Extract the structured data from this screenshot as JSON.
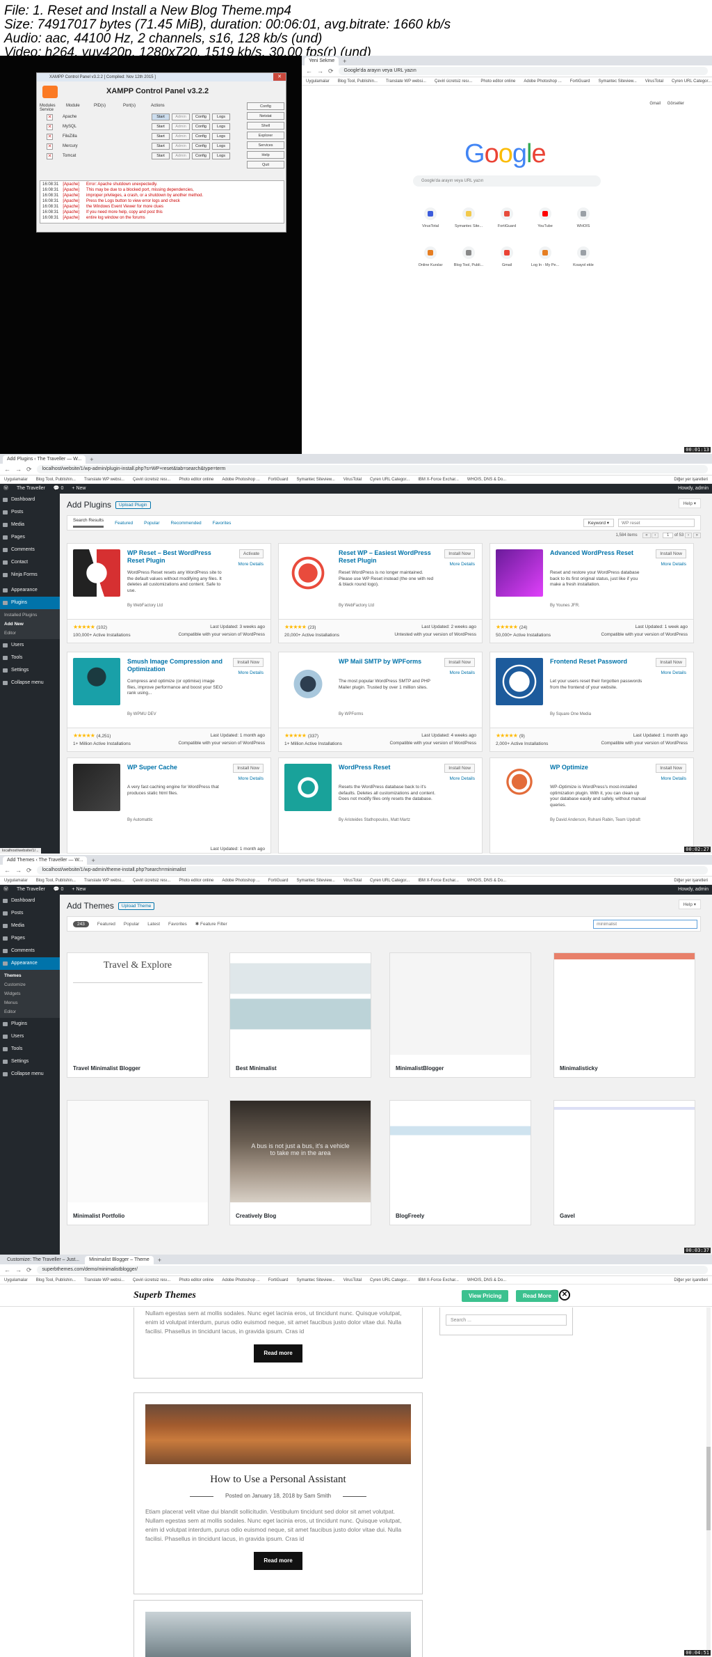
{
  "file_info": {
    "line1": "File: 1. Reset and Install a New Blog Theme.mp4",
    "line2": "Size: 74917017 bytes (71.45 MiB), duration: 00:06:01, avg.bitrate: 1660 kb/s",
    "line3": "Audio: aac, 44100 Hz, 2 channels, s16, 128 kb/s (und)",
    "line4": "Video: h264, yuv420p, 1280x720, 1519 kb/s, 30.00 fps(r) (und)"
  },
  "timestamps": [
    "00:01:13",
    "00:02:27",
    "00:03:37",
    "00:04:51"
  ],
  "bookmarks": [
    "Uygulamalar",
    "Blog Tool, Publishin...",
    "Translate WP websi...",
    "Çeviri ücretsiz resı...",
    "Photo editor online",
    "Adobe Photoshop ...",
    "FortiGuard",
    "Symantec Siteview...",
    "VirusTotal",
    "Cyren URL Categor...",
    "IBM X-Force Exchar...",
    "WHOIS, DNS & Do..."
  ],
  "bookmarks_right": "Diğer yer işaretleri",
  "xampp": {
    "title": "XAMPP Control Panel v3.2.2   [ Compiled: Nov 12th 2015 ]",
    "heading": "XAMPP Control Panel v3.2.2",
    "columns": [
      "Modules Service",
      "Module",
      "PID(s)",
      "Port(s)",
      "Actions"
    ],
    "modules": [
      "Apache",
      "MySQL",
      "FileZilla",
      "Mercury",
      "Tomcat"
    ],
    "actions": [
      "Start",
      "Admin",
      "Config",
      "Logs"
    ],
    "side_buttons": [
      "Config",
      "Netstat",
      "Shell",
      "Explorer",
      "Services",
      "Help",
      "Quit"
    ],
    "log_times": [
      "16:08:31",
      "16:08:31",
      "16:08:31",
      "16:08:31",
      "16:08:31",
      "16:08:31",
      "16:08:31"
    ],
    "log_src": "[Apache]",
    "log_lines": [
      "Error: Apache shutdown unexpectedly.",
      "This may be due to a blocked port, missing dependencies,",
      "improper privileges, a crash, or a shutdown by another method.",
      "Press the Logs button to view error logs and check",
      "the Windows Event Viewer for more clues",
      "If you need more help, copy and post this",
      "entire log window on the forums"
    ]
  },
  "chrome_p1": {
    "tab": "Yeni Sekme",
    "address": "Google'da arayın veya URL yazın",
    "top_links": [
      "Gmail",
      "Görseller"
    ],
    "logo": "Google",
    "search_placeholder": "Google'da arayın veya URL yazın",
    "shortcuts_row1": [
      "VirusTotal",
      "Symantec Site...",
      "FortiGuard",
      "YouTube",
      "WHOIS"
    ],
    "shortcuts_row2": [
      "Online Kurslar",
      "Blog Tool, Publi...",
      "Gmail",
      "Log In - My Pe...",
      "Kısayol ekle"
    ]
  },
  "wp_plugins": {
    "tab": "Add Plugins ‹ The Traveller — W...",
    "url": "localhost/website/1/wp-admin/plugin-install.php?s=WP+reset&tab=search&type=term",
    "site": "The Traveller",
    "new": "+ New",
    "howdy": "Howdy, admin",
    "help": "Help ▾",
    "title": "Add Plugins",
    "upload": "Upload Plugin",
    "filters": [
      "Search Results",
      "Featured",
      "Popular",
      "Recommended",
      "Favorites"
    ],
    "keyword": "Keyword ▾",
    "search": "WP reset",
    "items_count": "1,584 items",
    "page": "1",
    "of_pages": "of 53",
    "status_link": "localhost/website/1/...",
    "menu": [
      "Dashboard",
      "Posts",
      "Media",
      "Pages",
      "Comments",
      "Contact",
      "Ninja Forms",
      "Appearance",
      "Plugins"
    ],
    "sub": [
      "Installed Plugins",
      "Add New",
      "Editor"
    ],
    "menu2": [
      "Users",
      "Tools",
      "Settings",
      "Collapse menu"
    ],
    "cards": [
      {
        "name": "WP Reset – Best WordPress Reset Plugin",
        "desc": "WordPress Reset resets any WordPress site to the default values without modifying any files. It deletes all customizations and content. Safe to use.",
        "by": "By WebFactory Ltd",
        "btn": "Activate",
        "more": "More Details",
        "rating": "(102)",
        "installs": "100,000+ Active Installations",
        "updated": "Last Updated: 3 weeks ago",
        "compat": "Compatible with your version of WordPress"
      },
      {
        "name": "Reset WP – Easiest WordPress Reset Plugin",
        "desc": "Reset WordPress is no longer maintained. Please use WP Reset instead (the one with red & black round logo).",
        "by": "By WebFactory Ltd",
        "btn": "Install Now",
        "more": "More Details",
        "rating": "(23)",
        "installs": "20,000+ Active Installations",
        "updated": "Last Updated: 2 weeks ago",
        "compat": "Untested with your version of WordPress"
      },
      {
        "name": "Advanced WordPress Reset",
        "desc": "Reset and restore your WordPress database back to its first original status, just like if you make a fresh installation.",
        "by": "By Younes JFR.",
        "btn": "Install Now",
        "more": "More Details",
        "rating": "(24)",
        "installs": "50,000+ Active Installations",
        "updated": "Last Updated: 1 week ago",
        "compat": "Compatible with your version of WordPress"
      },
      {
        "name": "Smush Image Compression and Optimization",
        "desc": "Compress and optimize (or optimise) image files, improve performance and boost your SEO rank using...",
        "by": "By WPMU DEV",
        "btn": "Install Now",
        "more": "More Details",
        "rating": "(4,251)",
        "installs": "1+ Million Active Installations",
        "updated": "Last Updated: 1 month ago",
        "compat": "Compatible with your version of WordPress"
      },
      {
        "name": "WP Mail SMTP by WPForms",
        "desc": "The most popular WordPress SMTP and PHP Mailer plugin. Trusted by over 1 million sites.",
        "by": "By WPForms",
        "btn": "Install Now",
        "more": "More Details",
        "rating": "(337)",
        "installs": "1+ Million Active Installations",
        "updated": "Last Updated: 4 weeks ago",
        "compat": "Compatible with your version of WordPress"
      },
      {
        "name": "Frontend Reset Password",
        "desc": "Let your users reset their forgotten passwords from the frontend of your website.",
        "by": "By Square One Media",
        "btn": "Install Now",
        "more": "More Details",
        "rating": "(9)",
        "installs": "2,000+ Active Installations",
        "updated": "Last Updated: 1 month ago",
        "compat": "Compatible with your version of WordPress"
      },
      {
        "name": "WP Super Cache",
        "desc": "A very fast caching engine for WordPress that produces static html files.",
        "by": "By Automattic",
        "btn": "Install Now",
        "more": "More Details",
        "rating": "",
        "installs": "",
        "updated": "Last Updated: 1 month ago",
        "compat": ""
      },
      {
        "name": "WordPress Reset",
        "desc": "Resets the WordPress database back to it's defaults. Deletes all customizations and content. Does not modify files only resets the database.",
        "by": "By Aristeides Stathopoulos, Matt Martz",
        "btn": "Install Now",
        "more": "More Details",
        "rating": "",
        "installs": "",
        "updated": "",
        "compat": ""
      },
      {
        "name": "WP Optimize",
        "desc": "WP-Optimize is WordPress's most-installed optimization plugin. With it, you can clean up your database easily and safely, without manual queries.",
        "by": "By David Anderson, Ruhani Rabin, Team Updraft",
        "btn": "Install Now",
        "more": "More Details",
        "rating": "",
        "installs": "",
        "updated": "",
        "compat": ""
      }
    ]
  },
  "wp_themes": {
    "tab": "Add Themes ‹ The Traveller — W...",
    "url": "localhost/website/1/wp-admin/theme-install.php?search=minimalist",
    "title": "Add Themes",
    "upload": "Upload Theme",
    "count": "243",
    "filters": [
      "Featured",
      "Popular",
      "Latest",
      "Favorites",
      "✱ Feature Filter"
    ],
    "search": "minimalist",
    "menu": [
      "Dashboard",
      "Posts",
      "Media",
      "Pages",
      "Comments",
      "Appearance"
    ],
    "sub": [
      "Themes",
      "Customize",
      "Widgets",
      "Menus",
      "Editor"
    ],
    "menu2": [
      "Plugins",
      "Users",
      "Tools",
      "Settings",
      "Collapse menu"
    ],
    "themes": [
      "Travel Minimalist Blogger",
      "Best Minimalist",
      "MinimalistBlogger",
      "Minimalisticky",
      "Minimalist Portfolio",
      "Creatively Blog",
      "BlogFreely",
      "Gavel"
    ],
    "travel_heading": "Travel & Explore",
    "creatively_text": "A bus is not just a bus, it's a vehicle to take me in the area"
  },
  "superb": {
    "tab1": "Customize: The Traveller – Just...",
    "tab2": "Minimalist Blogger – Theme",
    "url": "superbthemes.com/demo/minimalistblogger/",
    "logo": "Superb Themes",
    "view_pricing": "View Pricing",
    "read_more_hdr": "Read More",
    "close": "✕",
    "search_placeholder": "Search ...",
    "post1_text": "Nullam egestas sem at mollis sodales. Nunc eget lacinia eros, ut tincidunt nunc. Quisque volutpat, enim id volutpat interdum, purus odio euismod neque, sit amet faucibus justo dolor vitae dui. Nulla facilisi. Phasellus in tincidunt lacus, in gravida ipsum. Cras id",
    "read_more": "Read more",
    "post2_title": "How to Use a Personal Assistant",
    "post2_meta": "Posted on January 18, 2018 by Sam Smith",
    "post2_text": "Etiam placerat velit vitae dui blandit sollicitudin. Vestibulum tincidunt sed dolor sit amet volutpat. Nullam egestas sem at mollis sodales. Nunc eget lacinia eros, ut tincidunt nunc. Quisque volutpat, enim id volutpat interdum, purus odio euismod neque, sit amet faucibus justo dolor vitae dui. Nulla facilisi. Phasellus in tincidunt lacus, in gravida ipsum. Cras id"
  }
}
